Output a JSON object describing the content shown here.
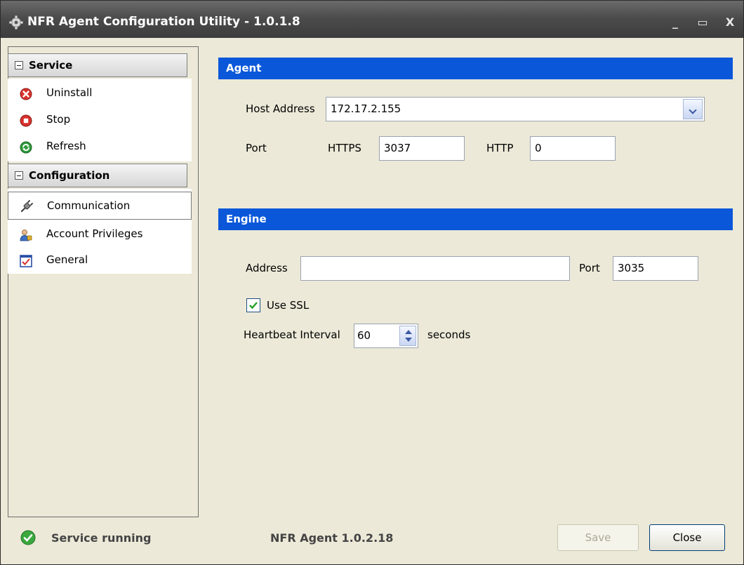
{
  "window": {
    "title": "NFR Agent Configuration Utility - 1.0.1.8",
    "minimize_glyph": "_",
    "maximize_glyph": "▭",
    "close_glyph": "X"
  },
  "sidebar": {
    "service_section": {
      "label": "Service",
      "items": [
        {
          "label": "Uninstall",
          "icon": "uninstall-icon"
        },
        {
          "label": "Stop",
          "icon": "stop-icon"
        },
        {
          "label": "Refresh",
          "icon": "refresh-icon"
        }
      ]
    },
    "configuration_section": {
      "label": "Configuration",
      "items": [
        {
          "label": "Communication",
          "icon": "plug-icon",
          "selected": true
        },
        {
          "label": "Account Privileges",
          "icon": "user-key-icon"
        },
        {
          "label": "General",
          "icon": "general-icon"
        }
      ]
    }
  },
  "agent": {
    "header": "Agent",
    "host_address_label": "Host Address",
    "host_address_value": "172.17.2.155",
    "port_label": "Port",
    "https_label": "HTTPS",
    "https_value": "3037",
    "http_label": "HTTP",
    "http_value": "0"
  },
  "engine": {
    "header": "Engine",
    "address_label": "Address",
    "address_value": "",
    "port_label": "Port",
    "port_value": "3035",
    "use_ssl_label": "Use SSL",
    "use_ssl_checked": true,
    "heartbeat_label": "Heartbeat Interval",
    "heartbeat_value": "60",
    "heartbeat_unit": "seconds"
  },
  "footer": {
    "status_text": "Service running",
    "version_text": "NFR Agent 1.0.2.18",
    "save_label": "Save",
    "close_label": "Close"
  },
  "colors": {
    "header_blue": "#0a57d9",
    "window_bg": "#ece9d8",
    "titlebar": "#4c4c4c"
  }
}
